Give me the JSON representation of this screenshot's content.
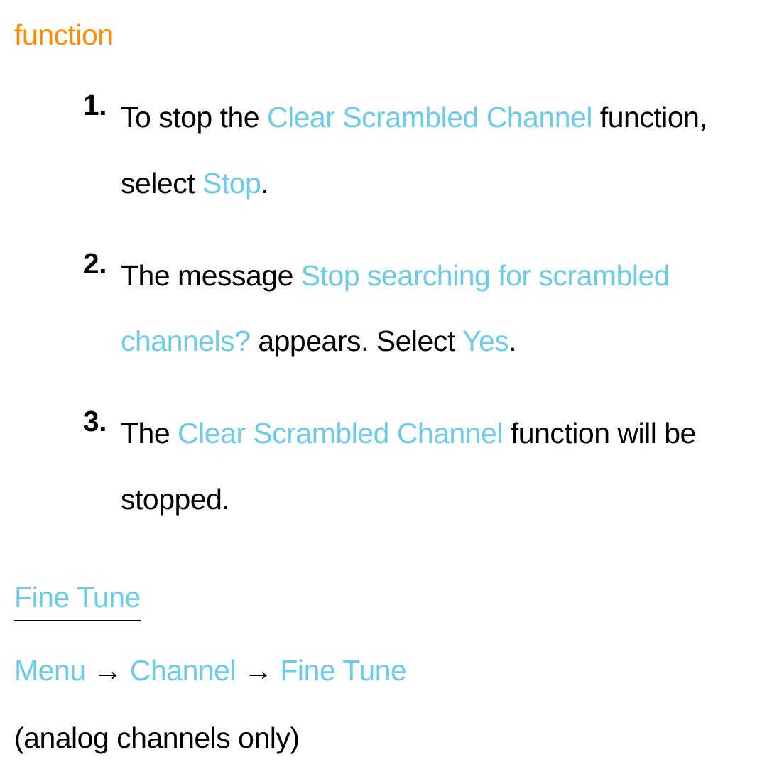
{
  "heading": "function",
  "steps": [
    {
      "num": "1.",
      "p1": "To stop the ",
      "h1": "Clear Scrambled Channel",
      "p2": " function, select ",
      "h2": "Stop",
      "p3": "."
    },
    {
      "num": "2.",
      "p1": "The message ",
      "h1": "Stop searching for scrambled channels?",
      "p2": " appears. Select ",
      "h2": "Yes",
      "p3": "."
    },
    {
      "num": "3.",
      "p1": "The ",
      "h1": "Clear Scrambled Channel",
      "p2": " function will be stopped."
    }
  ],
  "section_title": "Fine Tune",
  "breadcrumb": {
    "b1": "Menu",
    "arrow": " → ",
    "b2": "Channel",
    "b3": "Fine Tune"
  },
  "note": "(analog channels only)"
}
